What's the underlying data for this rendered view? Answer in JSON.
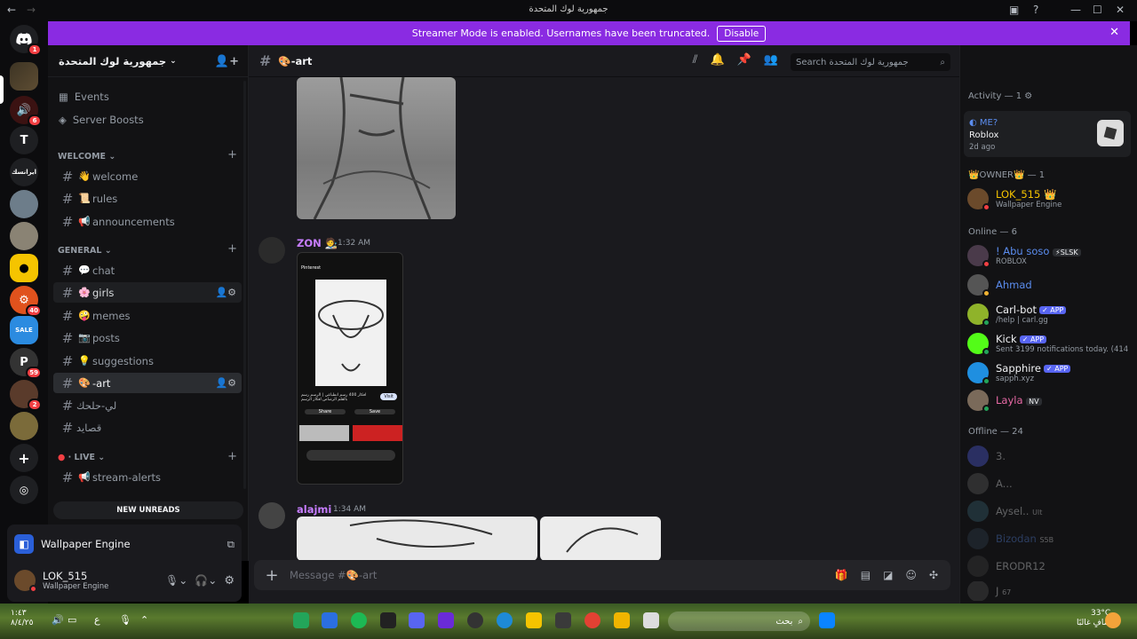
{
  "window": {
    "title": "جمهورية لوك المتحدة"
  },
  "banner": {
    "text": "Streamer Mode is enabled. Usernames have been truncated.",
    "disable_label": "Disable"
  },
  "servers": {
    "badges": [
      "1",
      "6",
      "40",
      "59",
      "2"
    ],
    "text_server": "T"
  },
  "guild": {
    "name": "جمهورية لوك المتحدة"
  },
  "nav": {
    "events": "Events",
    "boosts": "Server Boosts"
  },
  "categories": {
    "welcome": "WELCOME",
    "general": "GENERAL",
    "live": "LIVE"
  },
  "channels": [
    {
      "emoji": "👋",
      "name": "welcome"
    },
    {
      "emoji": "📜",
      "name": "rules"
    },
    {
      "emoji": "📢",
      "name": "announcements"
    },
    {
      "emoji": "💬",
      "name": "chat"
    },
    {
      "emoji": "🌸",
      "name": "girls"
    },
    {
      "emoji": "🤪",
      "name": "memes"
    },
    {
      "emoji": "📷",
      "name": "posts"
    },
    {
      "emoji": "💡",
      "name": "suggestions"
    },
    {
      "emoji": "🎨",
      "name": "-art"
    },
    {
      "emoji": "",
      "name": "لي-حلحك"
    },
    {
      "emoji": "",
      "name": "قصايد"
    },
    {
      "emoji": "📢",
      "name": "stream-alerts"
    }
  ],
  "new_unreads": "NEW UNREADS",
  "activity": {
    "app": "Wallpaper Engine"
  },
  "me": {
    "name": "LOK_515",
    "status": "Wallpaper Engine"
  },
  "chat": {
    "channel": "🎨-art",
    "search_placeholder": "Search جمهورية لوك المتحدة",
    "composer_placeholder": "Message #🎨-art",
    "messages": [
      {
        "author": "ZON 🧑‍🎨",
        "time": "1:32 AM",
        "color": "#c77dff"
      },
      {
        "author": "alajmi",
        "time": "1:34 AM",
        "color": "#c77dff"
      }
    ],
    "phone_texts": {
      "app": "Pinterest",
      "caption": "افكار 400 رسم انطباعي | الرسم رسم بالقلم الرصاص افكار الرسم",
      "visit": "Visit",
      "share": "Share",
      "save": "Save"
    }
  },
  "members": {
    "activity_head": "Activity — 1",
    "activity": {
      "user": "ME?",
      "game": "Roblox",
      "ago": "2d ago"
    },
    "owner_head": "👑OWNER👑 — 1",
    "owner": {
      "name": "LOK_515 👑",
      "sub": "Wallpaper Engine"
    },
    "online_head": "Online — 6",
    "online": [
      {
        "name": "! Abu soso",
        "tag": "⚡SLSK",
        "sub": "ROBLOX",
        "color": "#5b8def"
      },
      {
        "name": "Ahmad",
        "tag": "",
        "sub": "",
        "color": "#5b8def"
      },
      {
        "name": "Carl-bot",
        "tag": "✓ APP",
        "sub": "/help | carl.gg",
        "color": "#f2f3f5"
      },
      {
        "name": "Kick",
        "tag": "✓ APP",
        "sub": "Sent 3199 notifications today. (414...",
        "color": "#f2f3f5"
      },
      {
        "name": "Sapphire",
        "tag": "✓ APP",
        "sub": "sapph.xyz",
        "color": "#f2f3f5"
      },
      {
        "name": "Layla",
        "tag": "NV",
        "sub": "",
        "color": "#e86aa6"
      }
    ],
    "offline_head": "Offline — 24",
    "offline": [
      {
        "name": "3.",
        "tag": ""
      },
      {
        "name": "A...",
        "tag": ""
      },
      {
        "name": "Aysel..",
        "tag": "Ult"
      },
      {
        "name": "Bizodan",
        "tag": "S5B"
      },
      {
        "name": "ERODR12",
        "tag": ""
      },
      {
        "name": "J",
        "tag": "67"
      }
    ]
  },
  "taskbar": {
    "time": "١:٤٣",
    "date": "٨/٤/٢٥",
    "lang": "ع",
    "search": "بحث",
    "temp": "33°C",
    "weather": "صافٍ غالبًا"
  }
}
